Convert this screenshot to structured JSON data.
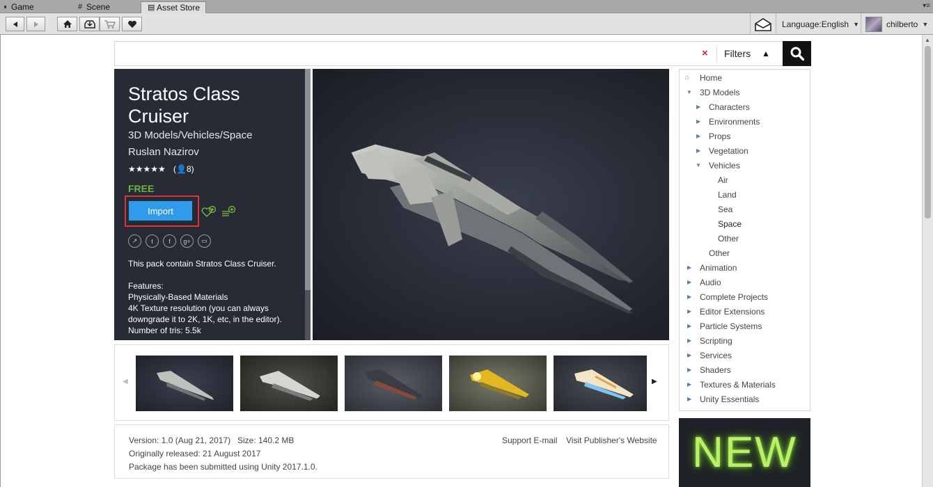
{
  "tabs": [
    {
      "label": "Game",
      "icon": "pacman-game-icon"
    },
    {
      "label": "Scene",
      "icon": "grid-scene-icon"
    },
    {
      "label": "Asset Store",
      "icon": "store-bag-icon",
      "active": true
    }
  ],
  "toolbar": {
    "language": "Language:English",
    "username": "chilberto"
  },
  "search": {
    "value": "",
    "clear_glyph": "×",
    "filters_label": "Filters"
  },
  "asset": {
    "title": "Stratos Class Cruiser",
    "category": "3D Models/Vehicles/Space",
    "publisher": "Ruslan Nazirov",
    "stars": "★★★★★",
    "rating_count": "(👤8)",
    "price": "FREE",
    "import_label": "Import",
    "description_lines": [
      "This pack contain Stratos Class Cruiser.",
      "",
      "Features:",
      "Physically-Based Materials",
      "4K Texture resolution (you can always downgrade it to 2K, 1K, etc, in the editor).",
      "Number of tris: 5.5k"
    ]
  },
  "meta": {
    "version": "Version: 1.0 (Aug 21, 2017)",
    "size": "Size: 140.2 MB",
    "released": "Originally released: 21 August 2017",
    "submitted": "Package has been submitted using Unity 2017.1.0.",
    "support": "Support E-mail",
    "website": "Visit Publisher's Website"
  },
  "tree": [
    {
      "label": "Home",
      "level": 0,
      "icon": "home-icon"
    },
    {
      "label": "3D Models",
      "level": 0,
      "expanded": true
    },
    {
      "label": "Characters",
      "level": 1
    },
    {
      "label": "Environments",
      "level": 1
    },
    {
      "label": "Props",
      "level": 1
    },
    {
      "label": "Vegetation",
      "level": 1
    },
    {
      "label": "Vehicles",
      "level": 1,
      "expanded": true
    },
    {
      "label": "Air",
      "level": 2
    },
    {
      "label": "Land",
      "level": 2
    },
    {
      "label": "Sea",
      "level": 2
    },
    {
      "label": "Space",
      "level": 2,
      "selected": true
    },
    {
      "label": "Other",
      "level": 2
    },
    {
      "label": "Other",
      "level": 1,
      "leaf": true
    },
    {
      "label": "Animation",
      "level": 0
    },
    {
      "label": "Audio",
      "level": 0
    },
    {
      "label": "Complete Projects",
      "level": 0
    },
    {
      "label": "Editor Extensions",
      "level": 0
    },
    {
      "label": "Particle Systems",
      "level": 0
    },
    {
      "label": "Scripting",
      "level": 0
    },
    {
      "label": "Services",
      "level": 0
    },
    {
      "label": "Shaders",
      "level": 0
    },
    {
      "label": "Textures & Materials",
      "level": 0
    },
    {
      "label": "Unity Essentials",
      "level": 0
    }
  ],
  "banner": {
    "text": "NEW"
  },
  "colors": {
    "import_button": "#2f9bea",
    "price": "#6db33f",
    "panel_bg": "#262b36",
    "highlight_border": "#e03434"
  }
}
